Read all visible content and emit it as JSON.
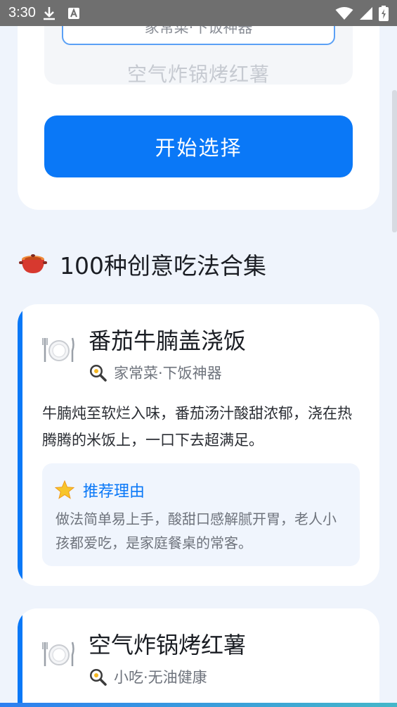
{
  "status_bar": {
    "time": "3:30",
    "icons": [
      "download-icon",
      "text-a-icon",
      "wifi-icon",
      "signal-icon",
      "battery-icon"
    ]
  },
  "picker": {
    "selected_label": "家常菜·下饭神器",
    "next_option": "空气炸锅烤红薯"
  },
  "start_button": {
    "label": "开始选择"
  },
  "section": {
    "icon": "pot-icon",
    "title": "100种创意吃法合集"
  },
  "recipes": [
    {
      "title": "番茄牛腩盖浇饭",
      "tags": "家常菜·下饭神器",
      "description": "牛腩炖至软烂入味，番茄汤汁酸甜浓郁，浇在热腾腾的米饭上，一口下去超满足。",
      "reason_title": "推荐理由",
      "reason_text": "做法简单易上手，酸甜口感解腻开胃，老人小孩都爱吃，是家庭餐桌的常客。"
    },
    {
      "title": "空气炸锅烤红薯",
      "tags": "小吃·无油健康"
    }
  ],
  "colors": {
    "accent": "#0a78f7",
    "background": "#eff4fc",
    "status_bar": "#6f6f6f"
  }
}
